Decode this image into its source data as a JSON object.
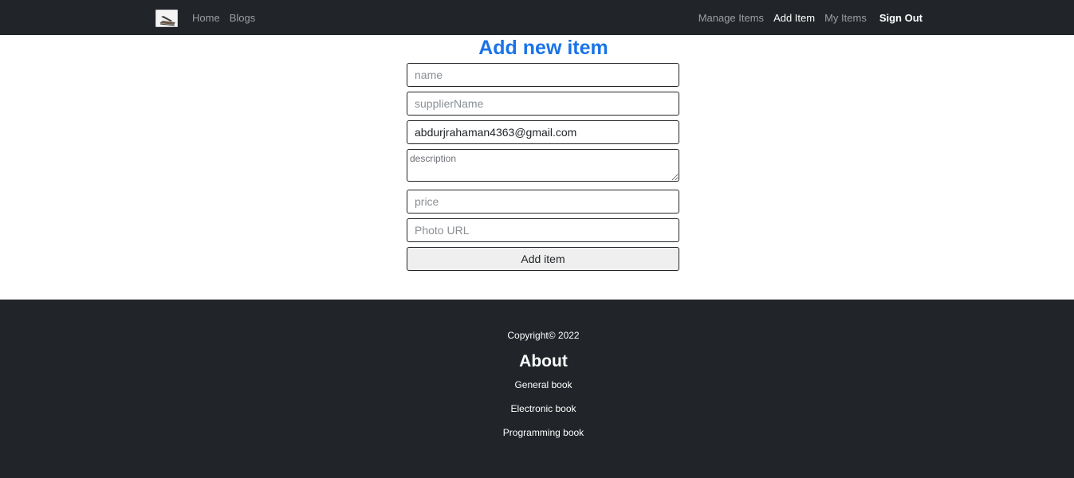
{
  "navbar": {
    "logo_icon": "book-logo-icon",
    "left_links": [
      {
        "label": "Home"
      },
      {
        "label": "Blogs"
      }
    ],
    "right_links": [
      {
        "label": "Manage Items",
        "active": false
      },
      {
        "label": "Add Item",
        "active": true
      },
      {
        "label": "My Items",
        "active": false
      }
    ],
    "sign_out_label": "Sign Out"
  },
  "form": {
    "title": "Add new item",
    "name_placeholder": "name",
    "supplier_placeholder": "supplierName",
    "email_value": "abdurjrahaman4363@gmail.com",
    "description_placeholder": "description",
    "price_placeholder": "price",
    "photo_placeholder": "Photo URL",
    "submit_label": "Add item"
  },
  "footer": {
    "copyright": "Copyright© 2022",
    "about_title": "About",
    "links": [
      {
        "label": "General book"
      },
      {
        "label": "Electronic book"
      },
      {
        "label": "Programming book"
      }
    ]
  },
  "colors": {
    "navbar_bg": "#212529",
    "title_blue": "#1a73e8",
    "footer_bg": "#212529"
  }
}
